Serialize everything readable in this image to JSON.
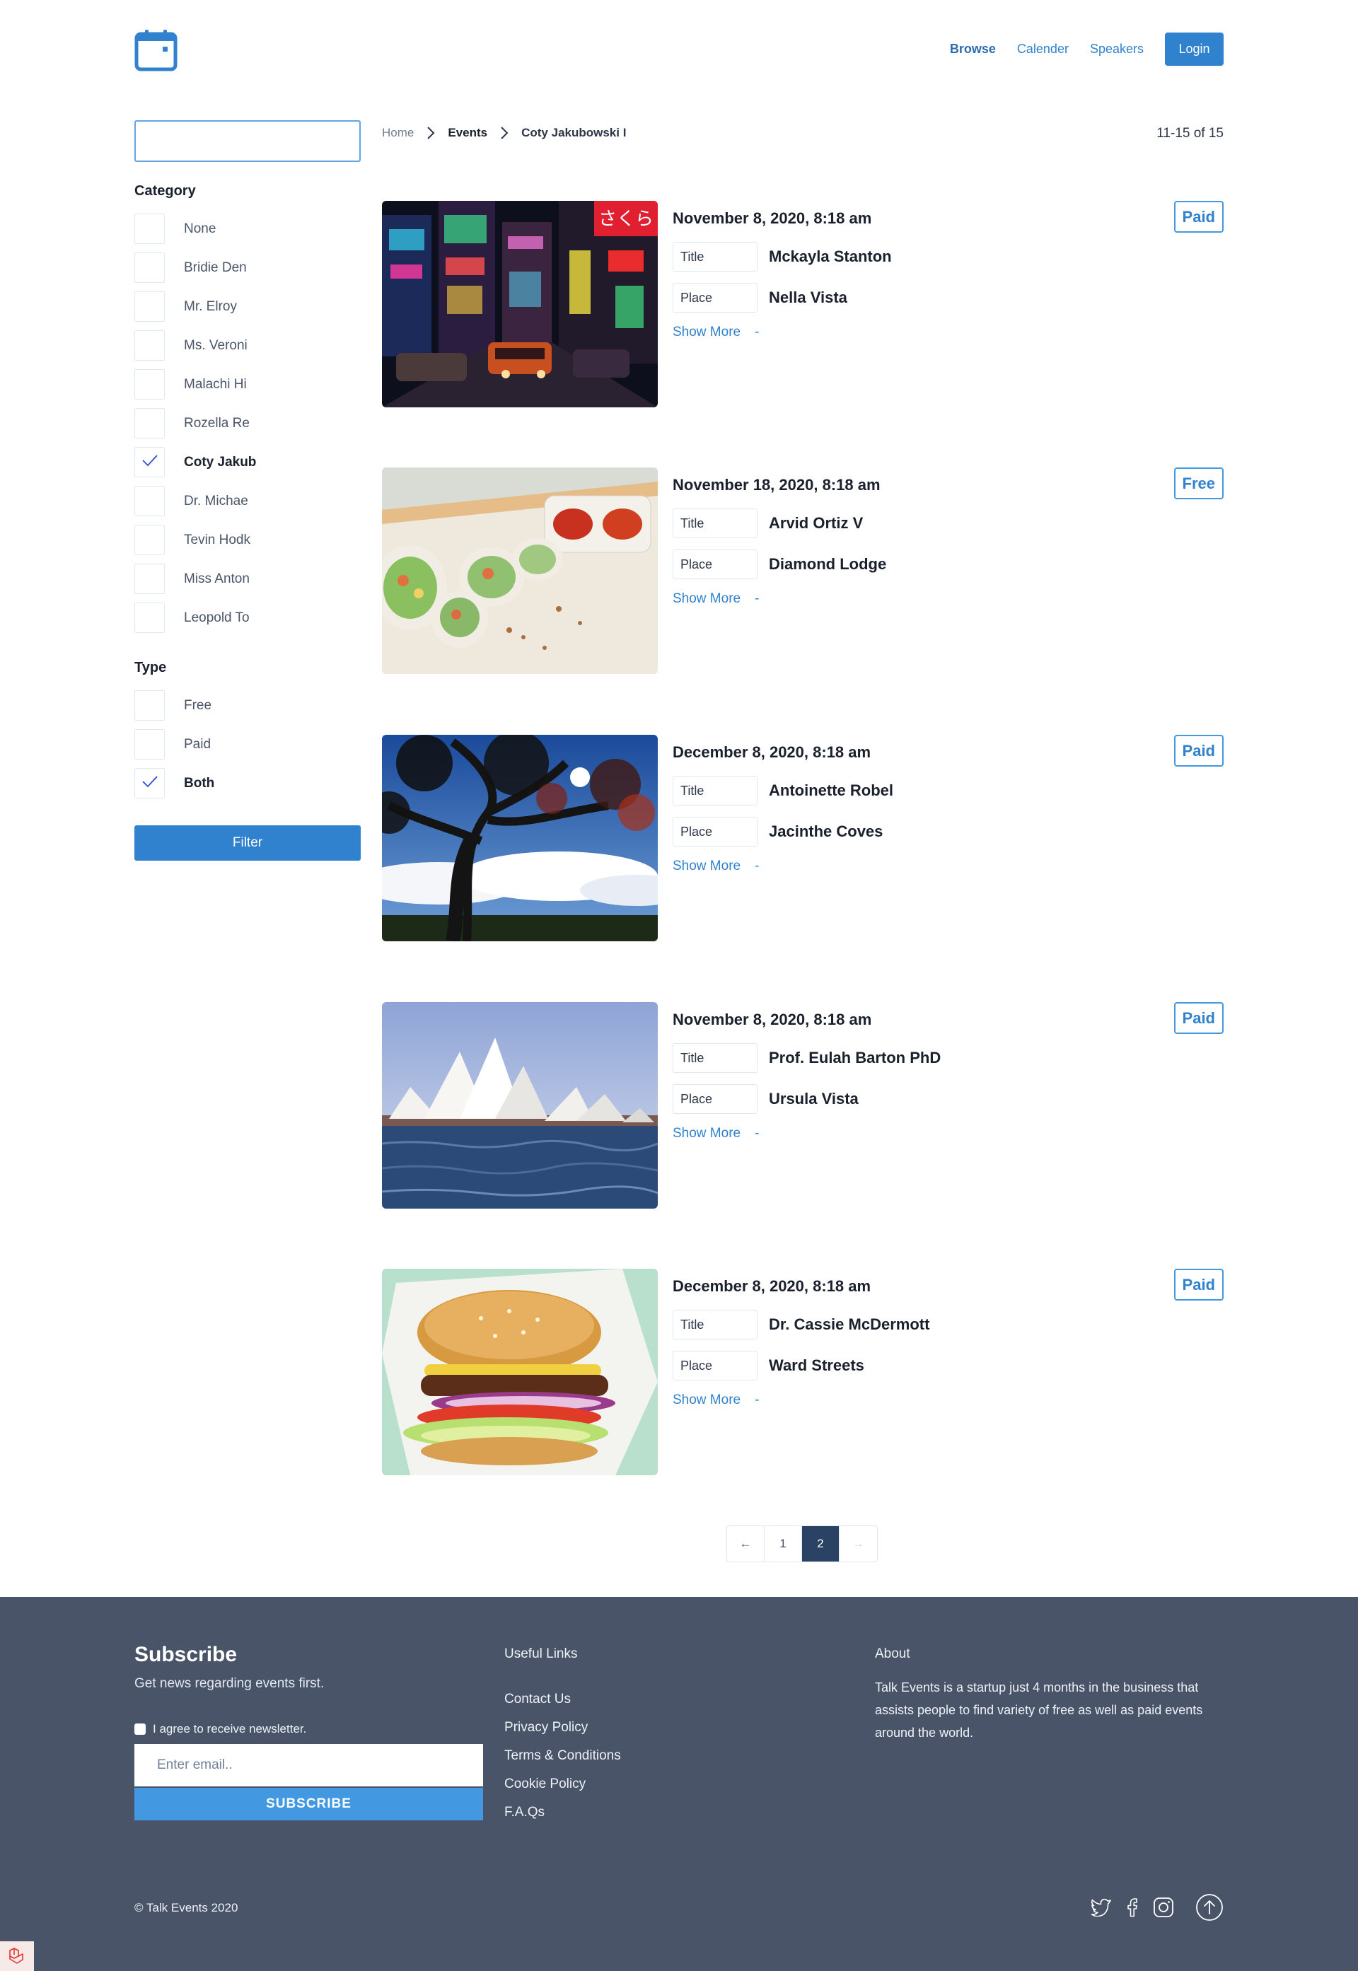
{
  "nav": {
    "browse": "Browse",
    "calendar": "Calender",
    "speakers": "Speakers",
    "login": "Login"
  },
  "sidebar": {
    "search_value": "",
    "category_title": "Category",
    "categories": [
      {
        "label": "None",
        "checked": false
      },
      {
        "label": "Bridie Den",
        "checked": false
      },
      {
        "label": "Mr. Elroy",
        "checked": false
      },
      {
        "label": "Ms. Veroni",
        "checked": false
      },
      {
        "label": "Malachi Hi",
        "checked": false
      },
      {
        "label": "Rozella Re",
        "checked": false
      },
      {
        "label": "Coty Jakub",
        "checked": true
      },
      {
        "label": "Dr. Michae",
        "checked": false
      },
      {
        "label": "Tevin Hodk",
        "checked": false
      },
      {
        "label": "Miss Anton",
        "checked": false
      },
      {
        "label": "Leopold To",
        "checked": false
      }
    ],
    "type_title": "Type",
    "types": [
      {
        "label": "Free",
        "checked": false
      },
      {
        "label": "Paid",
        "checked": false
      },
      {
        "label": "Both",
        "checked": true
      }
    ],
    "filter_button": "Filter"
  },
  "breadcrumb": [
    "Home",
    "Events",
    "Coty Jakubowski I"
  ],
  "result_count": "11-15 of 15",
  "events": [
    {
      "date": "November 8, 2020, 8:18 am",
      "badge": "Paid",
      "title_key": "Title",
      "title": "Mckayla Stanton",
      "place_key": "Place",
      "place": "Nella Vista",
      "show_more": "Show More",
      "dash": "-",
      "image": "city-night"
    },
    {
      "date": "November 18, 2020, 8:18 am",
      "badge": "Free",
      "title_key": "Title",
      "title": "Arvid Ortiz V",
      "place_key": "Place",
      "place": "Diamond Lodge",
      "show_more": "Show More",
      "dash": "-",
      "image": "spring-rolls"
    },
    {
      "date": "December 8, 2020, 8:18 am",
      "badge": "Paid",
      "title_key": "Title",
      "title": "Antoinette Robel",
      "place_key": "Place",
      "place": "Jacinthe Coves",
      "show_more": "Show More",
      "dash": "-",
      "image": "tree-sky"
    },
    {
      "date": "November 8, 2020, 8:18 am",
      "badge": "Paid",
      "title_key": "Title",
      "title": "Prof. Eulah Barton PhD",
      "place_key": "Place",
      "place": "Ursula Vista",
      "show_more": "Show More",
      "dash": "-",
      "image": "opera-house"
    },
    {
      "date": "December 8, 2020, 8:18 am",
      "badge": "Paid",
      "title_key": "Title",
      "title": "Dr. Cassie McDermott",
      "place_key": "Place",
      "place": "Ward Streets",
      "show_more": "Show More",
      "dash": "-",
      "image": "burger"
    }
  ],
  "pagination": {
    "prev": "←",
    "pages": [
      "1",
      "2"
    ],
    "current": "2",
    "next": "→"
  },
  "footer": {
    "subscribe_title": "Subscribe",
    "subscribe_text": "Get news regarding events first.",
    "agree_label": "I agree to receive newsletter.",
    "email_placeholder": "Enter email..",
    "subscribe_button": "SUBSCRIBE",
    "links_title": "Useful Links",
    "links": [
      "Contact Us",
      "Privacy Policy",
      "Terms & Conditions",
      "Cookie Policy",
      "F.A.Qs"
    ],
    "about_title": "About",
    "about_text": "Talk Events is a startup just 4 months in the business that assists people to find variety of free as well as paid events around the world.",
    "copyright": "© Talk Events 2020"
  },
  "colors": {
    "accent": "#3182ce",
    "footer_bg": "#4a5468",
    "current_page": "#2a4365"
  }
}
